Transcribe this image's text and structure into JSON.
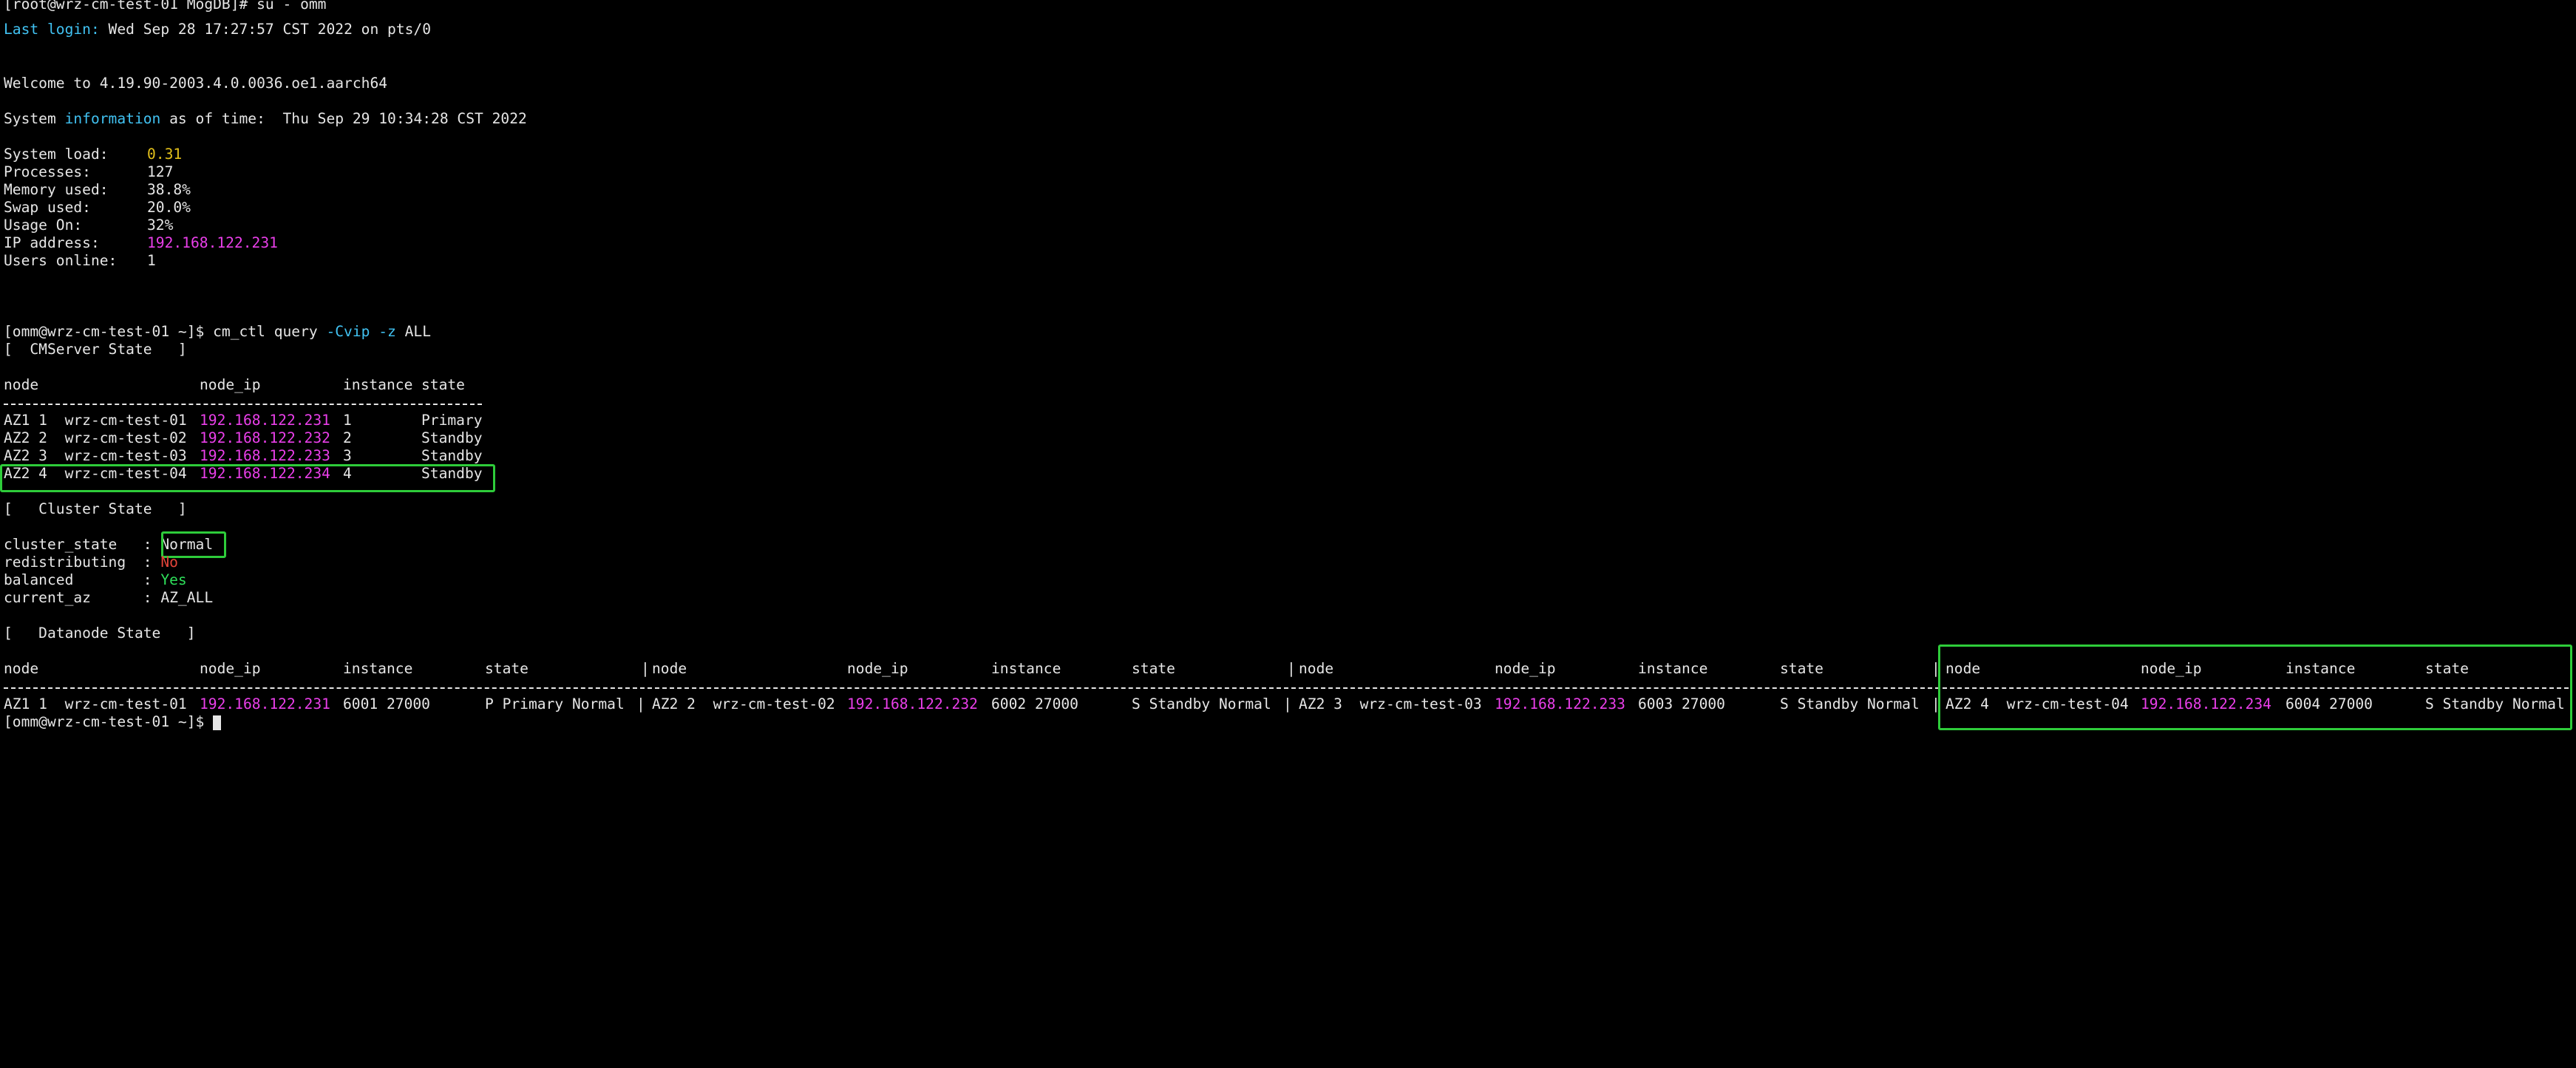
{
  "terminal": {
    "lines": {
      "l0": "[root@wrz-cm-test-01 MogDB]# su - omm",
      "l1a": "Last login:",
      "l1b": " Wed Sep 28 17:27:57 CST 2022 on pts/0",
      "l2": "Welcome to 4.19.90-2003.4.0.0036.oe1.aarch64",
      "l3a": "System ",
      "l3b": "information",
      "l3c": " as of time:  Thu Sep 29 10:34:28 CST 2022",
      "l4a": "System load:",
      "l4b": "0.31",
      "l5a": "Processes:",
      "l5b": "127",
      "l6a": "Memory used:",
      "l6b": "38.8%",
      "l7a": "Swap used:",
      "l7b": "20.0%",
      "l8a": "Usage On:",
      "l8b": "32%",
      "l9a": "IP address:",
      "l9b": "192.168.122.231",
      "l10a": "Users online:",
      "l10b": "1",
      "l11a": "[omm@wrz-cm-test-01 ~]$ cm_ctl query ",
      "l11b": "-Cvip -z",
      "l11c": " ALL",
      "l12": "[  CMServer State   ]",
      "l13a": "node",
      "l13b": "node_ip",
      "l13c": "instance",
      "l13d": "state",
      "l14a": "AZ1 1  wrz-cm-test-01",
      "l14b": "192.168.122.231",
      "l14c": "1",
      "l14d": "Primary",
      "l15a": "AZ2 2  wrz-cm-test-02",
      "l15b": "192.168.122.232",
      "l15c": "2",
      "l15d": "Standby",
      "l16a": "AZ2 3  wrz-cm-test-03",
      "l16b": "192.168.122.233",
      "l16c": "3",
      "l16d": "Standby",
      "l17a": "AZ2 4  wrz-cm-test-04",
      "l17b": "192.168.122.234",
      "l17c": "4",
      "l17d": "Standby",
      "l18": "[   Cluster State   ]",
      "l19a": "cluster_state   : ",
      "l19b": "Normal",
      "l20a": "redistributing  : ",
      "l20b": "No",
      "l21a": "balanced        : ",
      "l21b": "Yes",
      "l22a": "current_az      : ",
      "l22b": "AZ_ALL",
      "l23": "[   Datanode State   ]",
      "dn_h_node": "node",
      "dn_h_ip": "node_ip",
      "dn_h_inst": "instance",
      "dn_h_state": "state",
      "dn_pipe": "|",
      "dn1_node": "AZ1 1  wrz-cm-test-01",
      "dn1_ip": "192.168.122.231",
      "dn1_inst": "6001 27000",
      "dn1_state": "P Primary Normal",
      "dn2_node": "AZ2 2  wrz-cm-test-02",
      "dn2_ip": "192.168.122.232",
      "dn2_inst": "6002 27000",
      "dn2_state": "S Standby Normal",
      "dn3_node": "AZ2 3  wrz-cm-test-03",
      "dn3_ip": "192.168.122.233",
      "dn3_inst": "6003 27000",
      "dn3_state": "S Standby Normal",
      "dn4_node": "AZ2 4  wrz-cm-test-04",
      "dn4_ip": "192.168.122.234",
      "dn4_inst": "6004 27000",
      "dn4_state": "S Standby Normal",
      "l26": "[omm@wrz-cm-test-01 ~]$ "
    },
    "colors": {
      "background": "#000000",
      "text": "#e6e6e6",
      "cyan": "#41c2f2",
      "magenta": "#ea3fea",
      "yellow": "#e3c01b",
      "red": "#e6453a",
      "green": "#2ee05a",
      "highlight_box": "#2ecc3a"
    }
  }
}
